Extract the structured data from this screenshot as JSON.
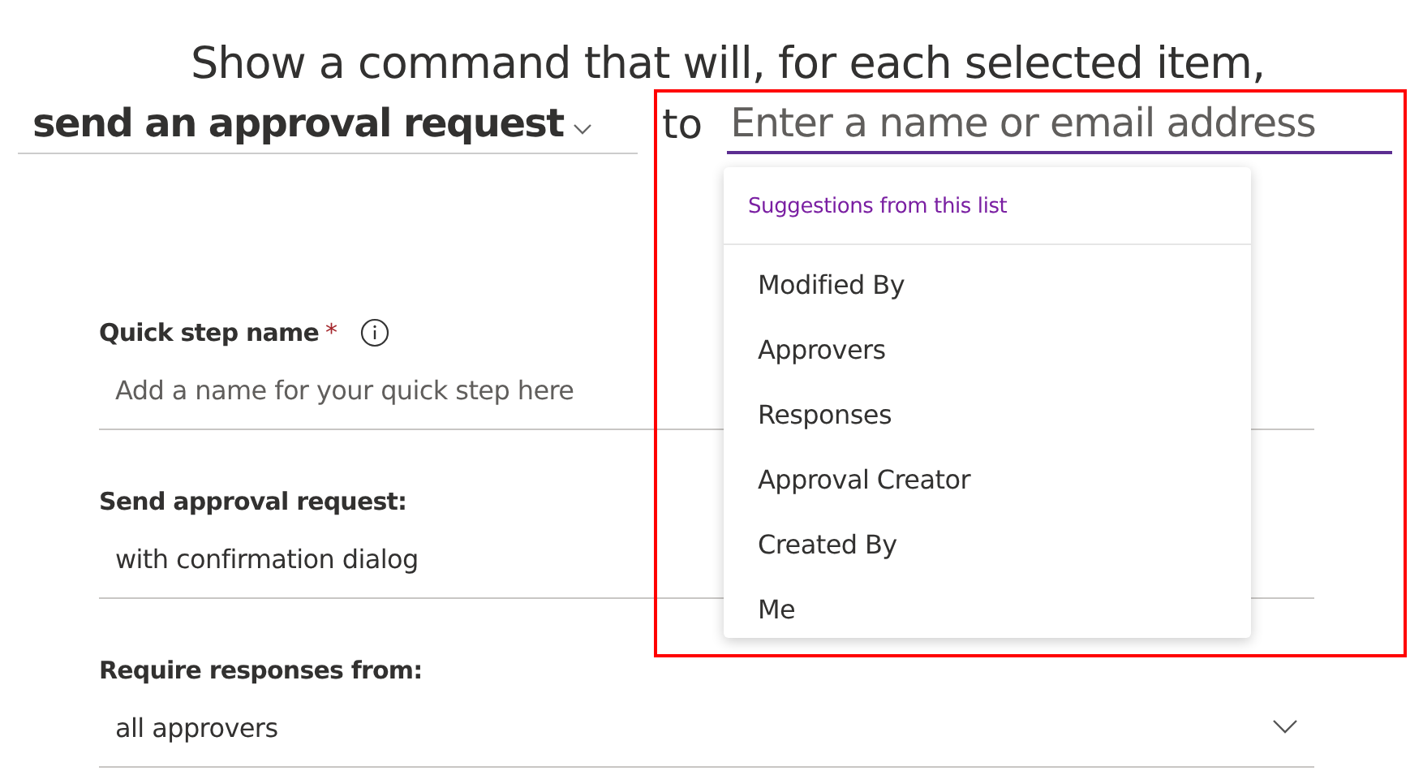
{
  "heading": {
    "line": "Show a command that will, for each selected item,",
    "action": "send an approval request",
    "connector": "to",
    "recipient": {
      "placeholder": "Enter a name or email address"
    }
  },
  "fields": [
    {
      "label": "Quick step name",
      "required_mark": "*",
      "info": true,
      "kind": "text",
      "placeholder": "Add a name for your quick step here"
    },
    {
      "label": "Send approval request:",
      "kind": "select",
      "value": "with confirmation dialog"
    },
    {
      "label": "Require responses from:",
      "kind": "dropdown",
      "value": "all approvers"
    }
  ],
  "suggestions": {
    "title": "Suggestions from this list",
    "items": [
      {
        "label": "Modified By"
      },
      {
        "label": "Approvers"
      },
      {
        "label": "Responses"
      },
      {
        "label": "Approval Creator"
      },
      {
        "label": "Created By"
      },
      {
        "label": "Me"
      }
    ]
  },
  "highlight": true
}
